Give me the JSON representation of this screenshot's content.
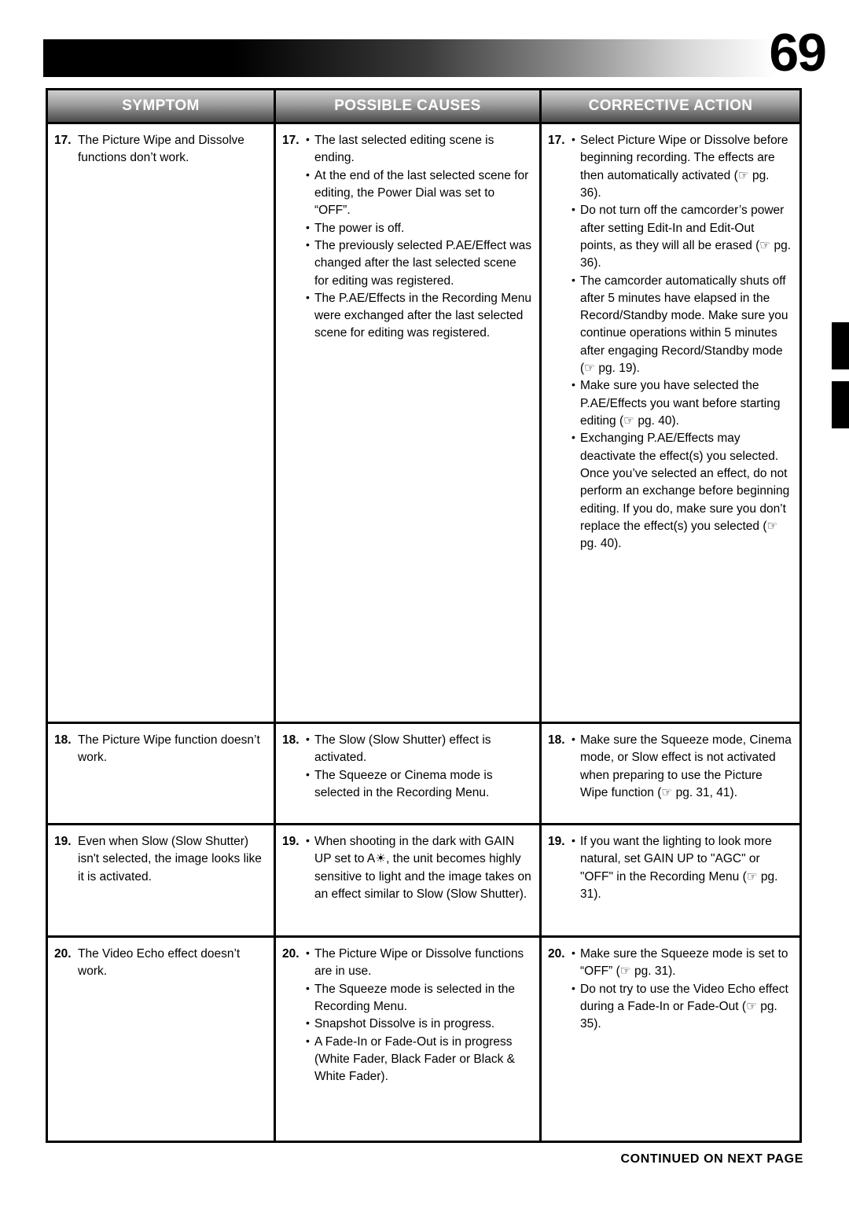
{
  "page": {
    "number": "69",
    "footer": "CONTINUED ON NEXT PAGE"
  },
  "table": {
    "headers": {
      "symptom": "SYMPTOM",
      "causes": "POSSIBLE CAUSES",
      "action": "CORRECTIVE ACTION"
    },
    "rows": [
      {
        "num": "17.",
        "symptom": "The Picture Wipe and Dissolve functions don’t work.",
        "causes": [
          "The last selected editing scene is ending.",
          "At the end of the last selected scene for editing, the Power Dial was set to “OFF”.",
          "The power is off.",
          "The previously selected P.AE/Effect was changed after the last selected scene for editing was registered.",
          "The P.AE/Effects in the Recording Menu were exchanged after the last selected scene for editing was registered."
        ],
        "actions": [
          "Select Picture Wipe or Dissolve before beginning recording. The effects are then automatically activated (☞ pg. 36).",
          "Do not turn off the camcorder’s power after setting Edit-In and Edit-Out points, as they will all be erased (☞ pg. 36).",
          "The camcorder automatically shuts off after 5 minutes have elapsed in the Record/Standby mode. Make sure you continue operations within 5 minutes after engaging Record/Standby mode (☞ pg. 19).",
          "Make sure you have selected the P.AE/Effects you want before starting editing (☞ pg. 40).",
          "Exchanging P.AE/Effects may deactivate the effect(s) you selected. Once you’ve selected an effect, do not perform an exchange before beginning editing. If you do, make sure you don’t replace the effect(s) you selected (☞ pg. 40)."
        ]
      },
      {
        "num": "18.",
        "symptom": "The Picture Wipe function doesn’t work.",
        "causes": [
          "The Slow (Slow Shutter) effect is activated.",
          "The Squeeze or Cinema mode is selected in the Recording Menu."
        ],
        "actions": [
          "Make sure the Squeeze mode, Cinema mode, or Slow effect is not activated when preparing to use the Picture Wipe function (☞ pg. 31, 41)."
        ]
      },
      {
        "num": "19.",
        "symptom": "Even when Slow (Slow Shutter) isn't selected, the image looks like it is activated.",
        "causes": [
          "When shooting in the dark with GAIN UP set to A☀, the unit becomes highly sensitive to light and the image takes on an effect similar to Slow (Slow Shutter)."
        ],
        "actions": [
          "If you want the lighting to look more natural, set GAIN UP to \"AGC\" or \"OFF\" in the Recording Menu (☞ pg. 31)."
        ]
      },
      {
        "num": "20.",
        "symptom": "The Video Echo effect doesn’t work.",
        "causes": [
          "The Picture Wipe or Dissolve functions are in use.",
          "The Squeeze mode is selected in the Recording Menu.",
          "Snapshot Dissolve is in progress.",
          "A Fade-In or Fade-Out is in progress (White Fader, Black Fader or Black & White Fader)."
        ],
        "actions": [
          "Make sure the Squeeze mode is set to “OFF” (☞ pg. 31).",
          "Do not try to use the Video Echo effect during a Fade-In or Fade-Out (☞ pg. 35)."
        ]
      }
    ]
  }
}
